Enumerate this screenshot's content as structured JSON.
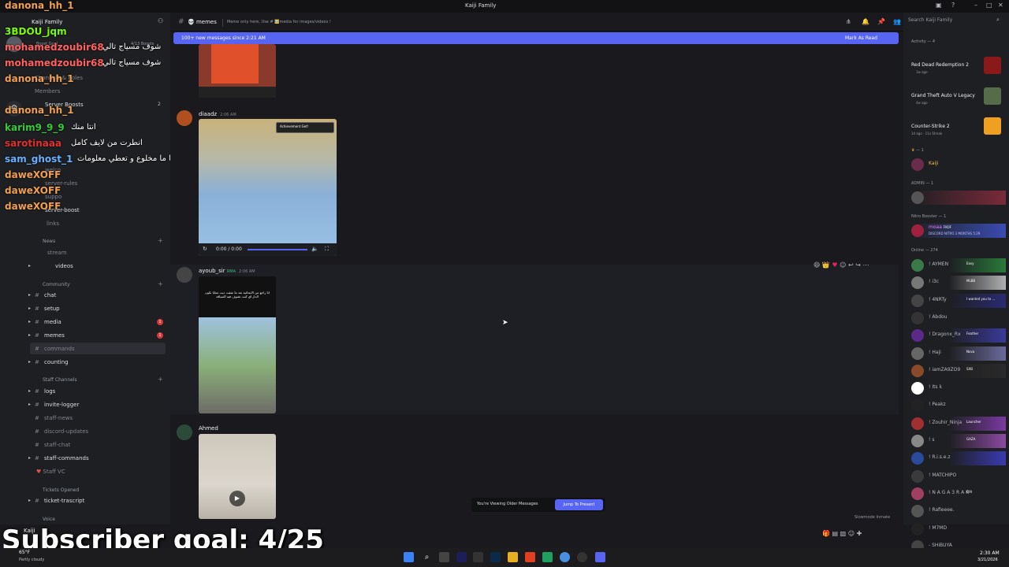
{
  "window": {
    "title": "Kaiji Family"
  },
  "server": {
    "name": "Kaiji Family",
    "boosts": "4/13 Boosts",
    "boost_goal": "Boost Goal"
  },
  "sidebar": {
    "top_items": [
      "Channels & Roles",
      "Members",
      "Server Boosts"
    ],
    "server_boosts_count": "2",
    "partial_channels": [
      "welco",
      "server-rules",
      "suppo",
      "server-boost",
      "links"
    ],
    "categories": {
      "news": "News",
      "community": "Community",
      "staff": "Staff Channels",
      "tickets": "Tickets Opened",
      "voice": "Voice"
    },
    "news_channels": [
      "stream",
      "videos"
    ],
    "community_channels": [
      "chat",
      "setup",
      "media",
      "memes",
      "commands",
      "counting"
    ],
    "badges": {
      "media": "1",
      "memes": "1"
    },
    "staff_channels": [
      "logs",
      "invite-logger",
      "staff-news",
      "discord-updates",
      "staff-chat",
      "staff-commands",
      "Staff VC"
    ],
    "ticket_channels": [
      "ticket-trascript"
    ],
    "user": {
      "name": "Kaiji"
    }
  },
  "overlay_chat": [
    {
      "user": "danona_hh_1",
      "text": "",
      "color": "#f0a050"
    },
    {
      "user": "3BDOU_jqm",
      "text": "",
      "color": "#7cfc00"
    },
    {
      "user": "mohamedzoubir68",
      "text": "شوف مسياج تالي",
      "color": "#ff6060"
    },
    {
      "user": "mohamedzoubir68",
      "text": "شوف مسياج تالي",
      "color": "#ff6060"
    },
    {
      "user": "danona_hh_1",
      "text": "",
      "color": "#f0a050"
    },
    {
      "user": "danona_hh_1",
      "text": "",
      "color": "#f0a050"
    },
    {
      "user": "karim9_9_9",
      "text": "انتا منك",
      "color": "#32cd32"
    },
    {
      "user": "sarotinaaa",
      "text": "انطرت من لايف كامل",
      "color": "#e03030"
    },
    {
      "user": "sam_ghost_1",
      "text": "اضحك بركا ما مخلوع و تعطي معلومات",
      "color": "#6ab0ff"
    },
    {
      "user": "daweXOFF",
      "text": "",
      "color": "#f0a050"
    },
    {
      "user": "daweXOFF",
      "text": "",
      "color": "#f0a050"
    },
    {
      "user": "daweXOFF",
      "text": "",
      "color": "#f0a050"
    }
  ],
  "channel": {
    "name": "memes",
    "topic": "Meme only here, Use # 🖼️media for images/videos !",
    "banner_text": "100+ new messages since 2:21 AM",
    "mark_read": "Mark As Read"
  },
  "messages": [
    {
      "author": "diaadz",
      "time": "2:06 AM",
      "badge": "Achievement Get!",
      "video_time": "0:00 / 0:00"
    },
    {
      "author": "ayoub_sir",
      "tag": "RMA",
      "time": "2:06 AM",
      "caption": "انا راجع من الابتدائية بعد ما عتقت ديت معايا تكون الدار اي كنت تشوف فيه السياقة"
    },
    {
      "author": "Ahmed",
      "time": ""
    }
  ],
  "older_bar": {
    "text": "You're Viewing Older Messages",
    "jump": "Jump To Present"
  },
  "slowmode": "Slowmode Inmate",
  "rightbar": {
    "search_placeholder": "Search Kaiji Family",
    "activity_header": "Activity — 4",
    "activities": [
      {
        "title": "Red Dead Redemption 2",
        "sub": "1w ago"
      },
      {
        "title": "Grand Theft Auto V Legacy",
        "sub": "4w ago"
      },
      {
        "title": "Counter-Strike 2",
        "sub": "1d ago · 11x Streak"
      }
    ],
    "owner_header": "— 1",
    "owner": "Kaiji",
    "admin_header": "ADMIN — 1",
    "booster_header": "Nitro Booster — 1",
    "booster": {
      "name": "moaa",
      "tag": "FKOF",
      "sub": "DISCORD NITRO 3 MONTHS 5:29"
    },
    "online_header": "Online — 274",
    "online": [
      {
        "name": "! AYMEN",
        "tag": "Easy"
      },
      {
        "name": "! i3c",
        "tag": "MLBB"
      },
      {
        "name": "! 4NRTy",
        "tag": "I wanted you to ..."
      },
      {
        "name": "! Abdou",
        "tag": ""
      },
      {
        "name": "! Dragonx_Rx",
        "tag": "Feather"
      },
      {
        "name": "! Haji",
        "tag": "Nova"
      },
      {
        "name": "! iamZA9ZO9",
        "tag": "SXB"
      },
      {
        "name": "! Its k",
        "tag": ""
      },
      {
        "name": "! Peakz",
        "tag": ""
      },
      {
        "name": "! Zouhir_Ninja",
        "tag": "Launcher"
      },
      {
        "name": "! s",
        "tag": "GAZA"
      },
      {
        "name": "! R.i.s.e.z",
        "tag": ""
      },
      {
        "name": "! MATCHIPO",
        "tag": ""
      },
      {
        "name": "! N A G A 3 R A K",
        "tag": "OAI"
      },
      {
        "name": "! Rafieeee.",
        "tag": ""
      },
      {
        "name": "! M7MD",
        "tag": ""
      },
      {
        "name": "- SHiBUYA",
        "tag": ""
      }
    ]
  },
  "overlay": {
    "subscriber_goal": "Subscriber goal: 4/25"
  },
  "weather": {
    "temp": "65°F",
    "desc": "Partly cloudy"
  },
  "clock": {
    "time": "2:30 AM",
    "date": "3/21/2026"
  }
}
